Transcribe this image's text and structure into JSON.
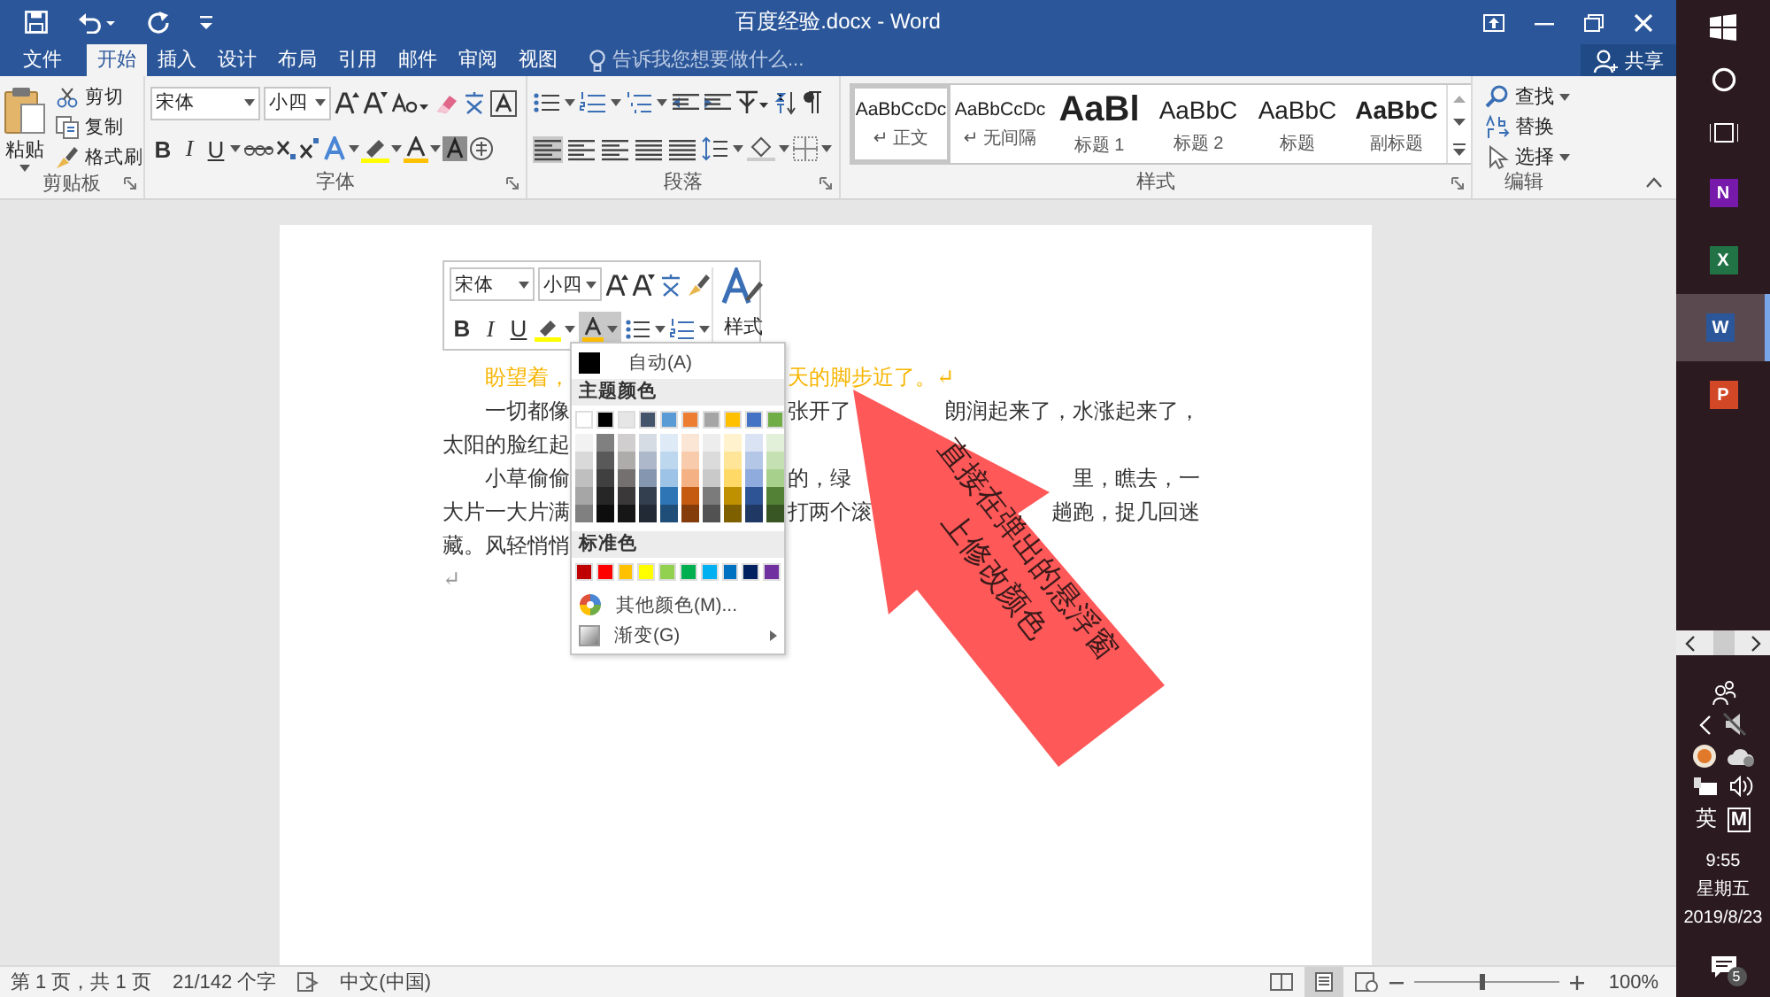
{
  "title_bar": {
    "title": "百度经验.docx - Word"
  },
  "tabs": [
    {
      "label": "文件",
      "kind": "file",
      "selected": false
    },
    {
      "label": "开始",
      "kind": "tab",
      "selected": true
    },
    {
      "label": "插入",
      "kind": "tab",
      "selected": false
    },
    {
      "label": "设计",
      "kind": "tab",
      "selected": false
    },
    {
      "label": "布局",
      "kind": "tab",
      "selected": false
    },
    {
      "label": "引用",
      "kind": "tab",
      "selected": false
    },
    {
      "label": "邮件",
      "kind": "tab",
      "selected": false
    },
    {
      "label": "审阅",
      "kind": "tab",
      "selected": false
    },
    {
      "label": "视图",
      "kind": "tab",
      "selected": false
    }
  ],
  "tell_me": {
    "placeholder": "告诉我您想要做什么..."
  },
  "share": {
    "label": "共享"
  },
  "ribbon": {
    "clipboard": {
      "label": "剪贴板",
      "paste": "粘贴",
      "items": [
        "剪切",
        "复制",
        "格式刷"
      ]
    },
    "font": {
      "label": "字体",
      "font_name": "宋体",
      "font_size": "小四",
      "format": [
        "B",
        "I",
        "U"
      ]
    },
    "paragraph": {
      "label": "段落"
    },
    "styles": {
      "label": "样式",
      "items": [
        {
          "preview": "AaBbCcDc",
          "name": "↵ 正文",
          "kind": "normal",
          "selected": true
        },
        {
          "preview": "AaBbCcDc",
          "name": "↵ 无间隔",
          "kind": "normal",
          "selected": false
        },
        {
          "preview": "AaBl",
          "name": "标题 1",
          "kind": "heading1",
          "selected": false
        },
        {
          "preview": "AaBbC",
          "name": "标题 2",
          "kind": "heading2",
          "selected": false
        },
        {
          "preview": "AaBbC",
          "name": "标题",
          "kind": "title",
          "selected": false
        },
        {
          "preview": "AaBbC",
          "name": "副标题",
          "kind": "subtitle",
          "selected": false
        }
      ]
    },
    "editing": {
      "label": "编辑",
      "items": [
        "查找",
        "替换",
        "选择"
      ]
    }
  },
  "document": {
    "lines": [
      {
        "kind": "indent",
        "left": "盼望着，",
        "right": [
          "天的脚步近了。↵"
        ],
        "color": "#f7b500"
      },
      {
        "kind": "indent",
        "left": "一切都像",
        "right": [
          "张开了",
          "朗润起来了，水涨起来了，"
        ],
        "color": "#333333"
      },
      {
        "kind": "plain",
        "left": "太阳的脸红起",
        "color": "#333333"
      },
      {
        "kind": "indent",
        "left": "小草偷偷",
        "right": [
          "的，绿",
          "里，瞧去，一"
        ],
        "color": "#333333"
      },
      {
        "kind": "plain",
        "left": "大片一大片满",
        "right": [
          "打两个滚",
          "趟跑，捉几回迷"
        ],
        "color": "#333333"
      },
      {
        "kind": "plain",
        "left": "藏。风轻悄悄",
        "color": "#333333"
      },
      {
        "kind": "plain",
        "left": "↵",
        "color": "#999999"
      }
    ]
  },
  "mini_toolbar": {
    "font_name": "宋体",
    "font_size": "小四",
    "format": [
      "B",
      "I",
      "U"
    ],
    "styles_label": "样式"
  },
  "color_menu": {
    "auto": "自动(A)",
    "theme_header": "主题颜色",
    "theme_colors": [
      {
        "color": "#ffffff",
        "shades": [
          {
            "color": "#f2f2f2"
          },
          {
            "color": "#d9d9d9"
          },
          {
            "color": "#bfbfbf"
          },
          {
            "color": "#a6a6a6"
          },
          {
            "color": "#808080"
          }
        ]
      },
      {
        "color": "#000000",
        "shades": [
          {
            "color": "#808080"
          },
          {
            "color": "#595959"
          },
          {
            "color": "#404040"
          },
          {
            "color": "#262626"
          },
          {
            "color": "#0d0d0d"
          }
        ]
      },
      {
        "color": "#e7e6e6",
        "shades": [
          {
            "color": "#d0cece"
          },
          {
            "color": "#aeabab"
          },
          {
            "color": "#757070"
          },
          {
            "color": "#3a3838"
          },
          {
            "color": "#171616"
          }
        ]
      },
      {
        "color": "#44546a",
        "shades": [
          {
            "color": "#d6dce4"
          },
          {
            "color": "#adb9ca"
          },
          {
            "color": "#8496b0"
          },
          {
            "color": "#333f4f"
          },
          {
            "color": "#222a35"
          }
        ]
      },
      {
        "color": "#5b9bd5",
        "shades": [
          {
            "color": "#deebf6"
          },
          {
            "color": "#bdd7ee"
          },
          {
            "color": "#9dc3e6"
          },
          {
            "color": "#2e75b5"
          },
          {
            "color": "#1f4e79"
          }
        ]
      },
      {
        "color": "#ed7d31",
        "shades": [
          {
            "color": "#fbe5d5"
          },
          {
            "color": "#f7cbac"
          },
          {
            "color": "#f4b183"
          },
          {
            "color": "#c55a11"
          },
          {
            "color": "#843c0b"
          }
        ]
      },
      {
        "color": "#a5a5a5",
        "shades": [
          {
            "color": "#ededed"
          },
          {
            "color": "#dbdbdb"
          },
          {
            "color": "#c9c9c9"
          },
          {
            "color": "#7b7b7b"
          },
          {
            "color": "#525252"
          }
        ]
      },
      {
        "color": "#ffc000",
        "shades": [
          {
            "color": "#fff2cc"
          },
          {
            "color": "#ffe598"
          },
          {
            "color": "#ffd965"
          },
          {
            "color": "#bf9000"
          },
          {
            "color": "#7f6000"
          }
        ]
      },
      {
        "color": "#4472c4",
        "shades": [
          {
            "color": "#dae3f3"
          },
          {
            "color": "#b4c7e7"
          },
          {
            "color": "#8faadc"
          },
          {
            "color": "#2f5496"
          },
          {
            "color": "#1f3864"
          }
        ]
      },
      {
        "color": "#70ad47",
        "shades": [
          {
            "color": "#e2efd9"
          },
          {
            "color": "#c5e0b3"
          },
          {
            "color": "#a8d08d"
          },
          {
            "color": "#538135"
          },
          {
            "color": "#375623"
          }
        ]
      }
    ],
    "standard_header": "标准色",
    "standard_colors": [
      {
        "color": "#c00000"
      },
      {
        "color": "#ff0000"
      },
      {
        "color": "#ffc000"
      },
      {
        "color": "#ffff00"
      },
      {
        "color": "#92d050"
      },
      {
        "color": "#00b050"
      },
      {
        "color": "#00b0f0"
      },
      {
        "color": "#0070c0"
      },
      {
        "color": "#002060"
      },
      {
        "color": "#7030a0"
      }
    ],
    "more": "其他颜色(M)...",
    "gradient": "渐变(G)"
  },
  "annotation": {
    "lines": [
      "直接在弹出的悬浮窗",
      "上修改颜色"
    ]
  },
  "status_bar": {
    "page": "第 1 页，共 1 页",
    "words": "21/142 个字",
    "language": "中文(中国)",
    "views": [
      {
        "kind": "read",
        "selected": false
      },
      {
        "kind": "print",
        "selected": true
      },
      {
        "kind": "web",
        "selected": false
      }
    ],
    "zoom": {
      "level": 0.46,
      "reading": "100%"
    }
  },
  "taskbar": {
    "apps": [
      {
        "letter": "N",
        "color": "#7719aa",
        "selected": false
      },
      {
        "letter": "X",
        "color": "#217346",
        "selected": false
      },
      {
        "letter": "W",
        "color": "#2b579a",
        "selected": true
      },
      {
        "letter": "P",
        "color": "#d24726",
        "selected": false
      }
    ],
    "ime": "英",
    "ime_mode": "M",
    "time": "9:55",
    "weekday": "星期五",
    "date": "2019/8/23",
    "notifications": "5"
  }
}
